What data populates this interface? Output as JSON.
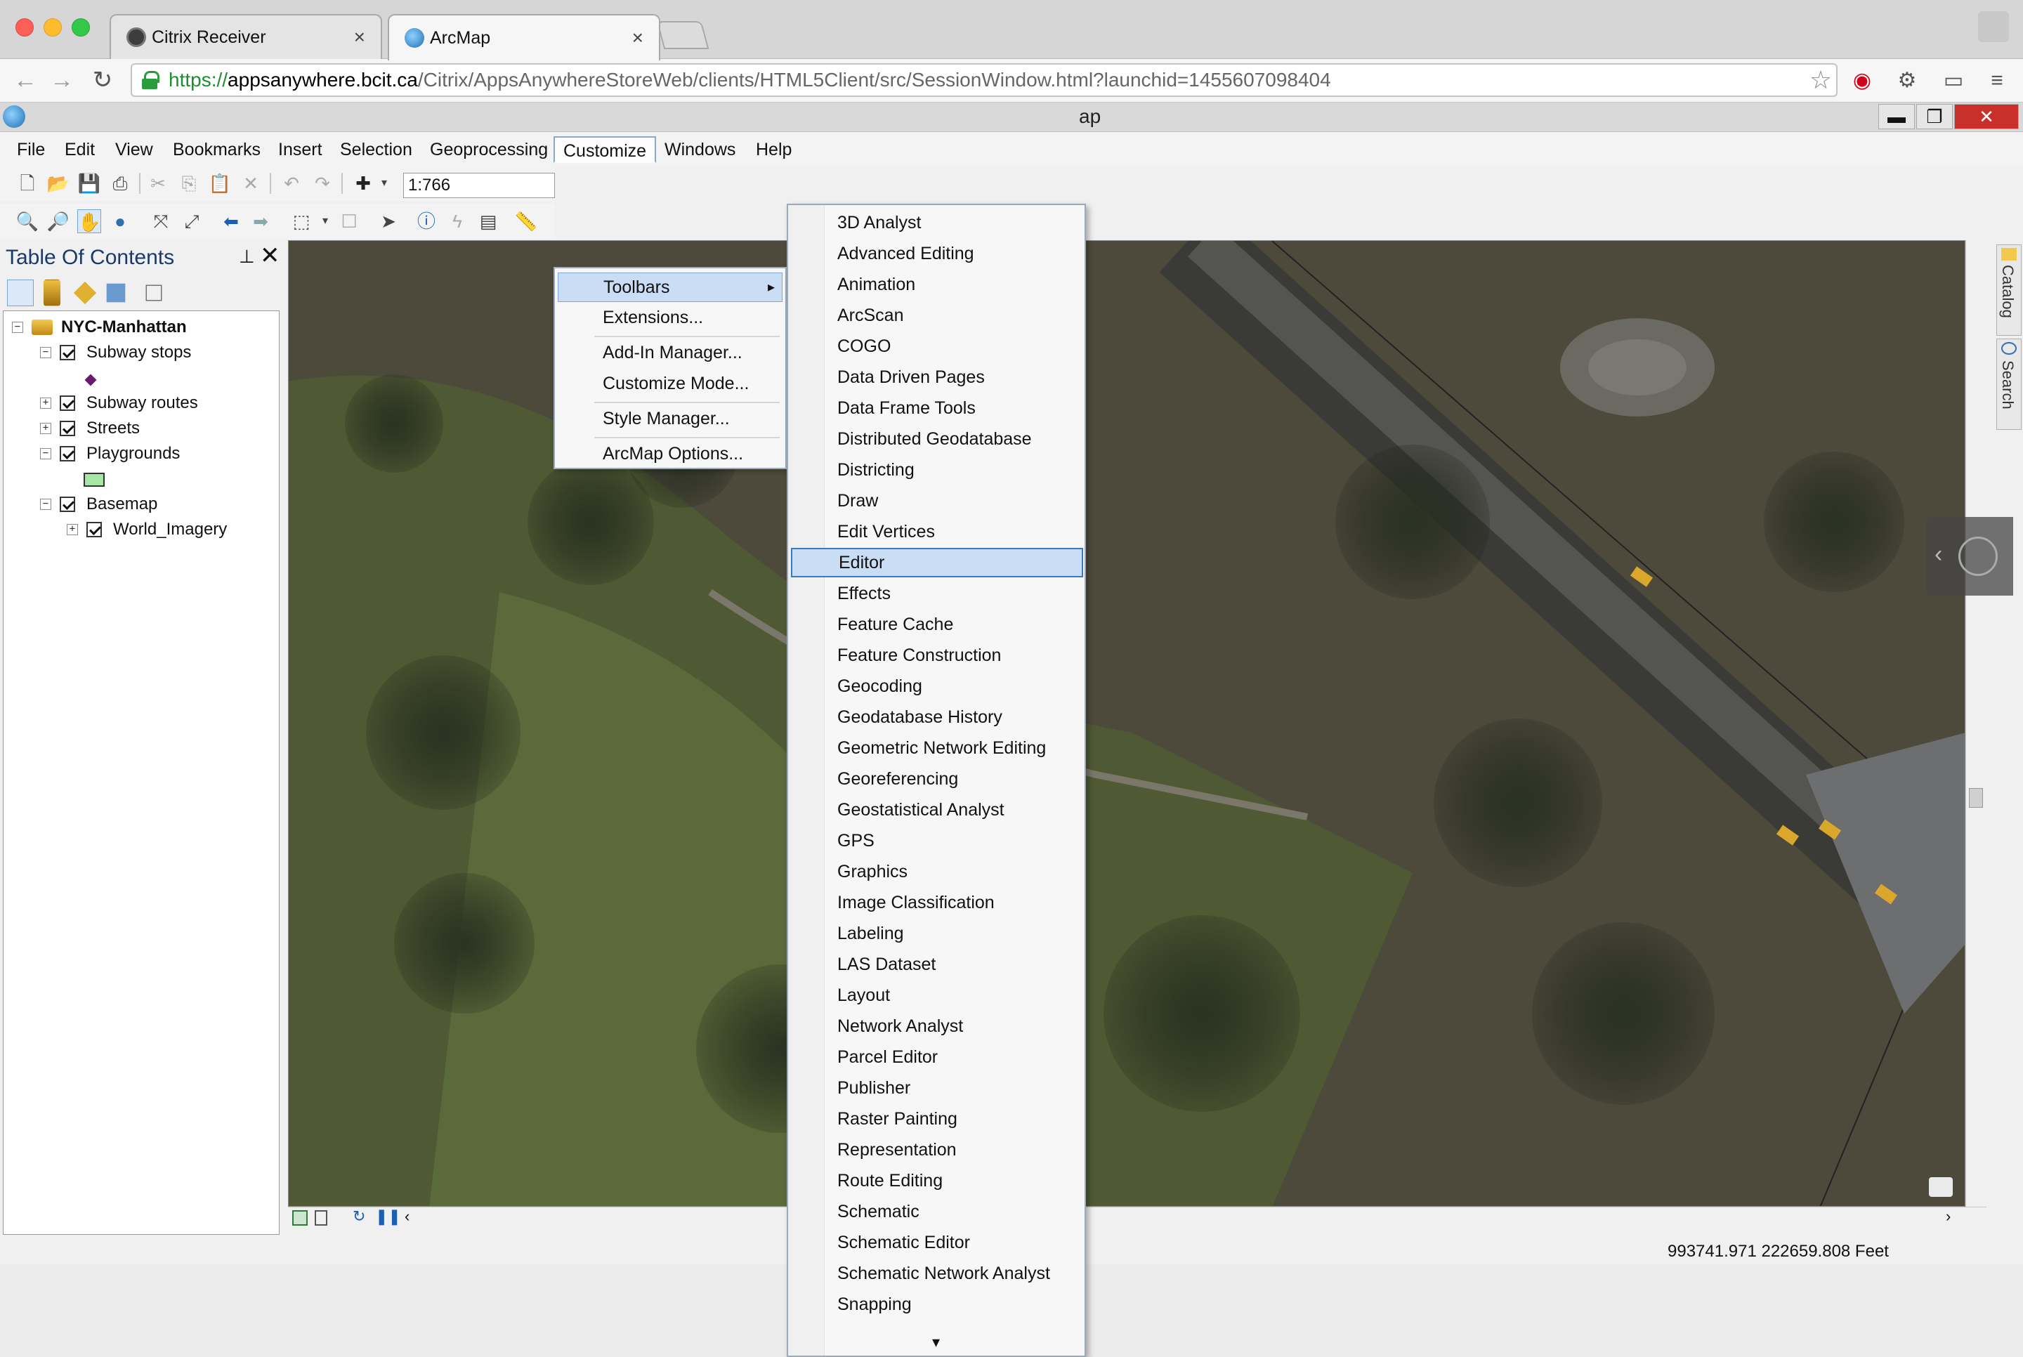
{
  "browser": {
    "tabs": [
      {
        "label": "Citrix Receiver",
        "close": "×"
      },
      {
        "label": "ArcMap",
        "close": "×"
      }
    ],
    "url": {
      "scheme": "https://",
      "host": "appsanywhere.bcit.ca",
      "path": "/Citrix/AppsAnywhereStoreWeb/clients/HTML5Client/src/SessionWindow.html?launchid=1455607098404"
    }
  },
  "app": {
    "title": "ap",
    "menubar": [
      "File",
      "Edit",
      "View",
      "Bookmarks",
      "Insert",
      "Selection",
      "Geoprocessing",
      "Customize",
      "Windows",
      "Help"
    ],
    "scale": "1:766",
    "window_buttons": {
      "minimize": "▬",
      "restore": "❐",
      "close": "✕"
    }
  },
  "toc": {
    "title": "Table Of Contents",
    "pin": "⊥",
    "close": "✕",
    "items": [
      {
        "label": "NYC-Manhattan",
        "expander": "−"
      },
      {
        "label": "Subway stops",
        "expander": "−"
      },
      {
        "label": "Subway routes",
        "expander": "+"
      },
      {
        "label": "Streets",
        "expander": "+"
      },
      {
        "label": "Playgrounds",
        "expander": "−"
      },
      {
        "label": "Basemap",
        "expander": "−"
      },
      {
        "label": "World_Imagery",
        "expander": "+"
      }
    ]
  },
  "customize_menu": {
    "items": [
      "Toolbars",
      "Extensions...",
      "Add-In Manager...",
      "Customize Mode...",
      "Style Manager...",
      "ArcMap Options..."
    ],
    "submenu_arrow": "▸"
  },
  "toolbars_menu": {
    "items": [
      "3D Analyst",
      "Advanced Editing",
      "Animation",
      "ArcScan",
      "COGO",
      "Data Driven Pages",
      "Data Frame Tools",
      "Distributed Geodatabase",
      "Districting",
      "Draw",
      "Edit Vertices",
      "Editor",
      "Effects",
      "Feature Cache",
      "Feature Construction",
      "Geocoding",
      "Geodatabase History",
      "Geometric Network Editing",
      "Georeferencing",
      "Geostatistical Analyst",
      "GPS",
      "Graphics",
      "Image Classification",
      "Labeling",
      "LAS Dataset",
      "Layout",
      "Network Analyst",
      "Parcel Editor",
      "Publisher",
      "Raster Painting",
      "Representation",
      "Route Editing",
      "Schematic",
      "Schematic Editor",
      "Schematic Network Analyst",
      "Snapping"
    ],
    "highlighted": "Editor",
    "more": "▾"
  },
  "right_dock": {
    "catalog": "Catalog",
    "search": "Search"
  },
  "status": {
    "coords": "993741.971  222659.808 Feet"
  },
  "colors": {
    "accent": "#3a78c8",
    "highlight": "#c9ddf5",
    "close_red": "#c9302c"
  }
}
